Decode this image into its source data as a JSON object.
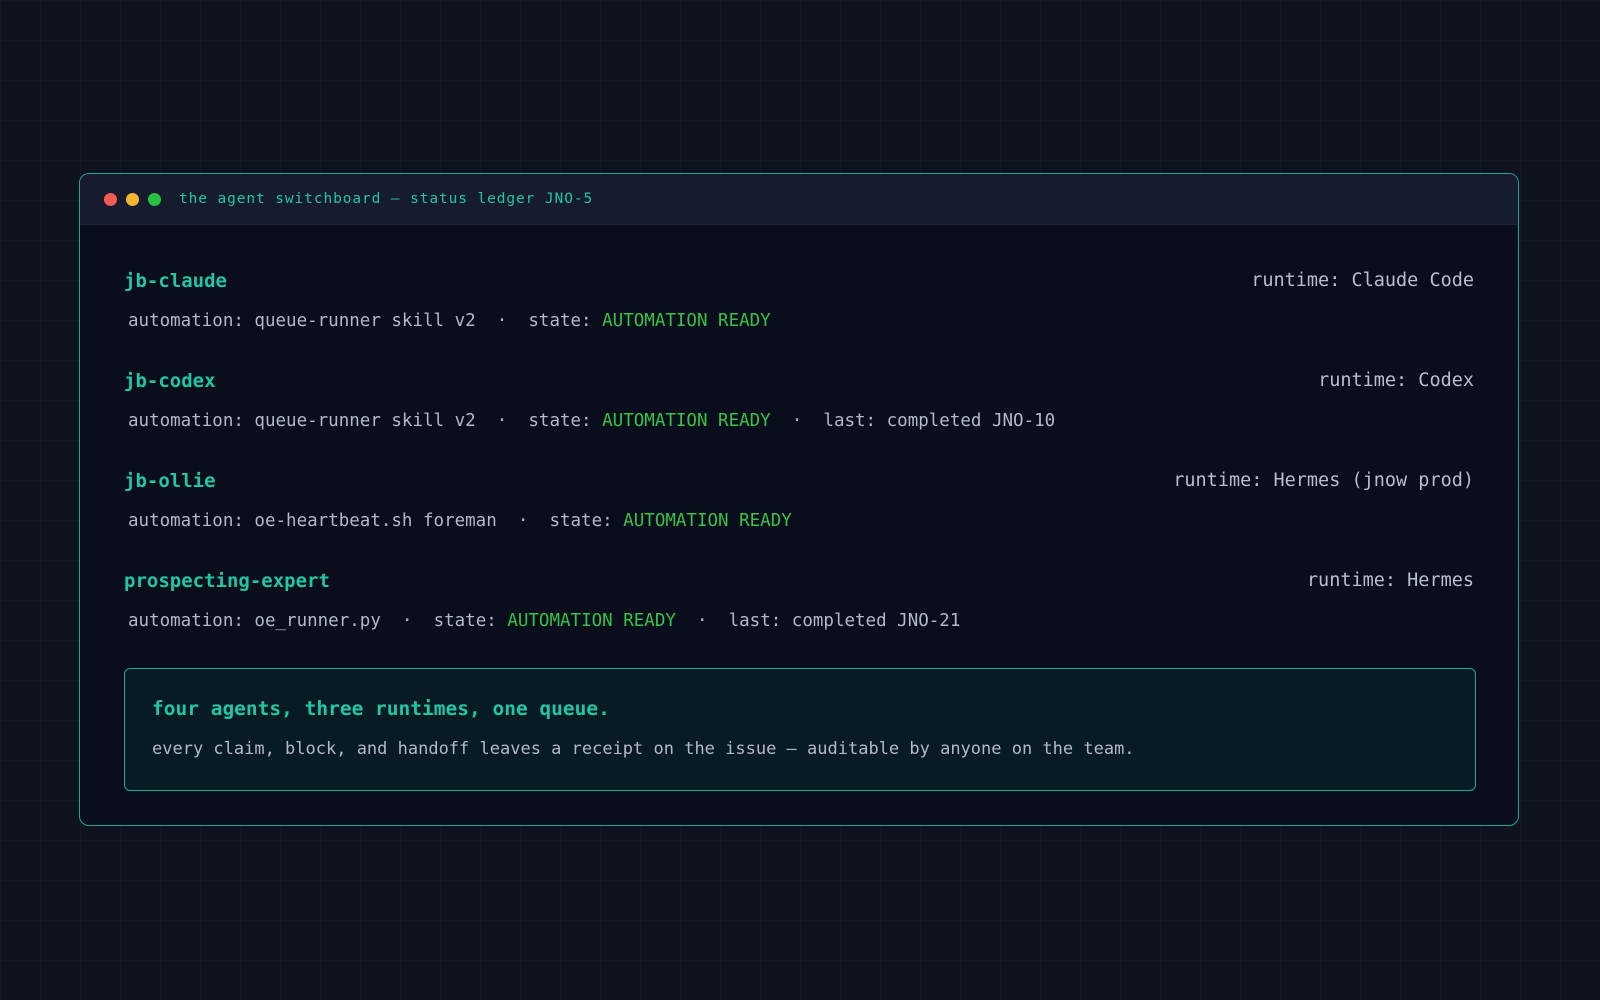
{
  "window": {
    "title": "the agent switchboard — status ledger JNO-5",
    "buttons": [
      "close",
      "minimize",
      "maximize"
    ]
  },
  "agents": [
    {
      "name": "jb-claude",
      "runtime": "runtime: Claude Code",
      "automation": "automation: queue-runner skill v2",
      "state_label": "state: ",
      "state": "AUTOMATION READY",
      "last": ""
    },
    {
      "name": "jb-codex",
      "runtime": "runtime: Codex",
      "automation": "automation: queue-runner skill v2",
      "state_label": "state: ",
      "state": "AUTOMATION READY",
      "last": "last: completed JNO-10"
    },
    {
      "name": "jb-ollie",
      "runtime": "runtime: Hermes (jnow prod)",
      "automation": "automation: oe-heartbeat.sh foreman",
      "state_label": "state: ",
      "state": "AUTOMATION READY",
      "last": ""
    },
    {
      "name": "prospecting-expert",
      "runtime": "runtime: Hermes",
      "automation": "automation: oe_runner.py",
      "state_label": "state: ",
      "state": "AUTOMATION READY",
      "last": "last: completed JNO-21"
    }
  ],
  "separator": "  ·  ",
  "callout": {
    "heading": "four agents, three runtimes, one queue.",
    "body": "every claim, block, and handoff leaves a receipt on the issue — auditable by anyone on the team."
  },
  "colors": {
    "accent": "#1fc7a4",
    "ready": "#35c348",
    "text": "#b3b9c6",
    "window_bg": "#0a0d1b",
    "page_bg": "#0f1320"
  }
}
